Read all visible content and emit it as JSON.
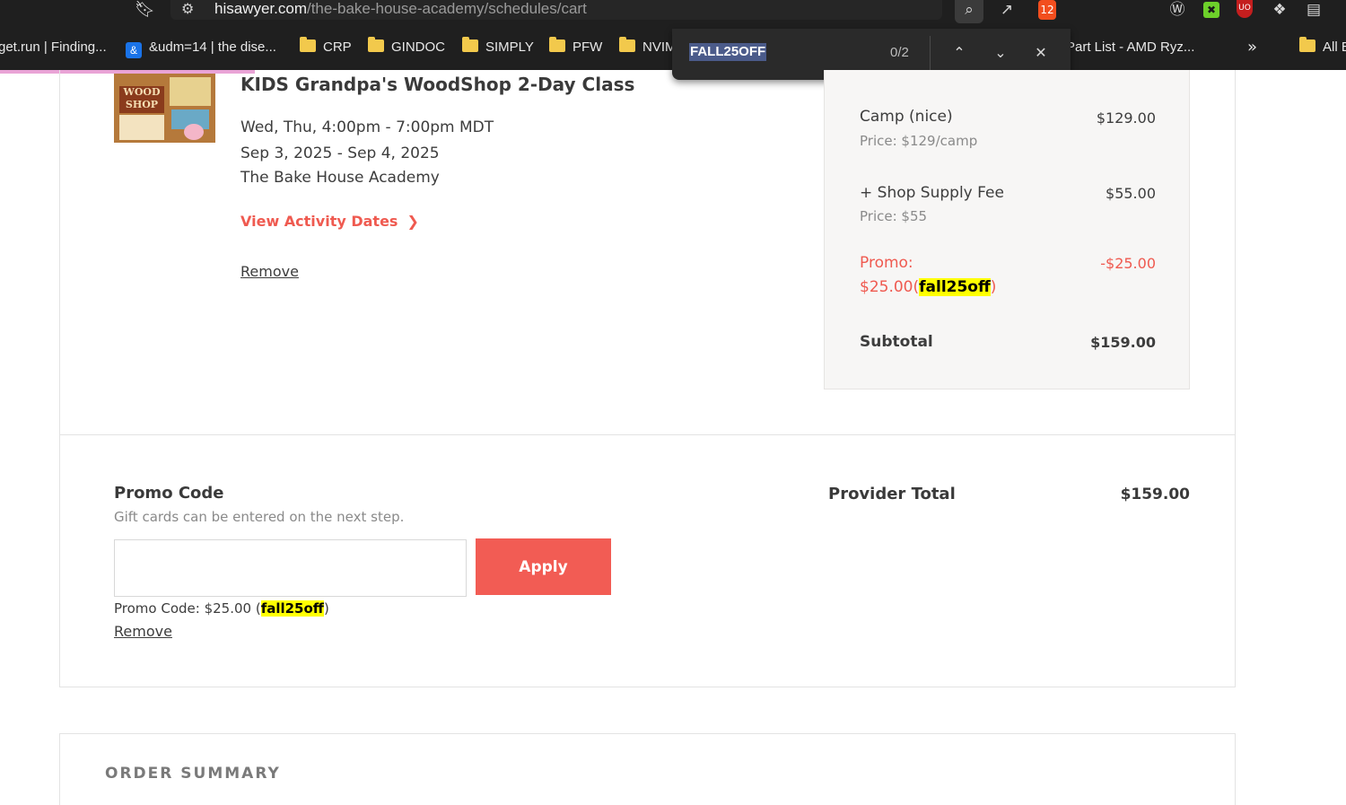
{
  "browser": {
    "url_host": "hisawyer.com",
    "url_path": "/the-bake-house-academy/schedules/cart",
    "bookmarks": [
      {
        "label": "get.run | Finding...",
        "type": "page"
      },
      {
        "label": "&udm=14 | the dise...",
        "type": "page"
      },
      {
        "label": "CRP",
        "type": "folder"
      },
      {
        "label": "GINDOC",
        "type": "folder"
      },
      {
        "label": "SIMPLY",
        "type": "folder"
      },
      {
        "label": "PFW",
        "type": "folder"
      },
      {
        "label": "NVIM",
        "type": "folder"
      },
      {
        "label": "Part List - AMD Ryz...",
        "type": "page"
      },
      {
        "label": "All B",
        "type": "folder"
      }
    ],
    "bookmarks_more": "»",
    "brave_badge": "12",
    "ublock_badge": "UO",
    "find": {
      "query": "FALL25OFF",
      "count": "0/2"
    },
    "icons": [
      "bookmark-icon",
      "site-settings-icon",
      "zoom-icon",
      "share-icon",
      "brave-icon",
      "wordpress-icon",
      "extension-green-icon",
      "ublock-icon",
      "puzzle-icon",
      "reading-list-icon",
      "chevron-up-icon",
      "chevron-down-icon",
      "close-icon"
    ]
  },
  "cart_item": {
    "title": "KIDS Grandpa's WoodShop 2-Day Class",
    "schedule": "Wed, Thu, 4:00pm - 7:00pm MDT",
    "dates": "Sep 3, 2025 - Sep 4, 2025",
    "provider": "The Bake House Academy",
    "view_dates_label": "View Activity Dates",
    "remove_label": "Remove",
    "thumbnail_text": "WOOD SHOP"
  },
  "price_breakdown": {
    "lines": [
      {
        "label": "Camp (nice)",
        "sub": "Price: $129/camp",
        "amount": "$129.00"
      },
      {
        "label": "+ Shop Supply Fee",
        "sub": "Price: $55",
        "amount": "$55.00"
      }
    ],
    "promo": {
      "label": "Promo:",
      "amount_text": "$25.00(",
      "code": "fall25off",
      "close": ")",
      "amount": "-$25.00"
    },
    "subtotal_label": "Subtotal",
    "subtotal": "$159.00"
  },
  "promo_section": {
    "heading": "Promo Code",
    "help": "Gift cards can be entered on the next step.",
    "input_value": "",
    "apply_label": "Apply",
    "applied_prefix": "Promo Code: $25.00 (",
    "applied_code": "fall25off",
    "applied_suffix": ")",
    "remove_label": "Remove"
  },
  "provider_total": {
    "label": "Provider Total",
    "value": "$159.00"
  },
  "order_summary": {
    "heading": "ORDER SUMMARY"
  },
  "colors": {
    "accent": "#f25c54",
    "highlight": "#ffff00",
    "chrome_bg": "#1f1f1f"
  }
}
